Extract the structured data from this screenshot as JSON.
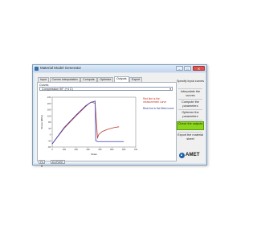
{
  "window": {
    "title": "Material Model Generator",
    "minimize": "–",
    "maximize": "□",
    "close": "✕"
  },
  "tabs": [
    {
      "label": "Input"
    },
    {
      "label": "Curves Interpolation"
    },
    {
      "label": "Compute"
    },
    {
      "label": "Optimize"
    },
    {
      "label": "Outputs"
    },
    {
      "label": "Export"
    }
  ],
  "active_tab": 4,
  "panel": {
    "curves_label": "Curves",
    "selected_curve": "Compression 90° (+4 C)",
    "legend_red": "Red line is the measurement curve",
    "legend_blue": "Blue line is the fitted curve",
    "btn_left": "Fit it",
    "btn_right": "EXPORT"
  },
  "sidebar": {
    "items": [
      {
        "label": "Specify input curves"
      },
      {
        "label": "Interpolate the curves"
      },
      {
        "label": "Compute the parameters"
      },
      {
        "label": "Optimize the parameters"
      },
      {
        "label": "Check the outputs"
      },
      {
        "label": "Export the material sheet"
      }
    ],
    "highlight_index": 4
  },
  "logo": {
    "text": "AMET"
  },
  "colors": {
    "measured": "#c0392b",
    "fitted": "#3a3fb3",
    "highlight": "#8cd61e"
  },
  "chart_data": {
    "type": "line",
    "xlabel": "Strain",
    "ylabel": "Stress [MPa]",
    "xlim": [
      0,
      700
    ],
    "ylim": [
      -80,
      240
    ],
    "yticks": [
      -80,
      -40,
      0,
      40,
      80,
      120,
      160,
      200,
      240
    ],
    "xticks": [
      0,
      100,
      200,
      300,
      400,
      500,
      600,
      700
    ],
    "grid": false,
    "series": [
      {
        "name": "Measurement",
        "x": [
          0,
          100,
          200,
          280,
          310,
          330,
          360,
          380,
          380,
          390,
          420,
          470,
          520,
          560
        ],
        "y": [
          -60,
          40,
          120,
          180,
          200,
          210,
          200,
          -25,
          -20,
          0,
          20,
          35,
          45,
          50
        ]
      },
      {
        "name": "Fit",
        "x": [
          0,
          100,
          200,
          280,
          320,
          360,
          365,
          380,
          420,
          470,
          520,
          560,
          600
        ],
        "y": [
          -60,
          45,
          125,
          185,
          205,
          215,
          -40,
          -45,
          -45,
          -45,
          -45,
          -45,
          -45
        ]
      }
    ]
  }
}
